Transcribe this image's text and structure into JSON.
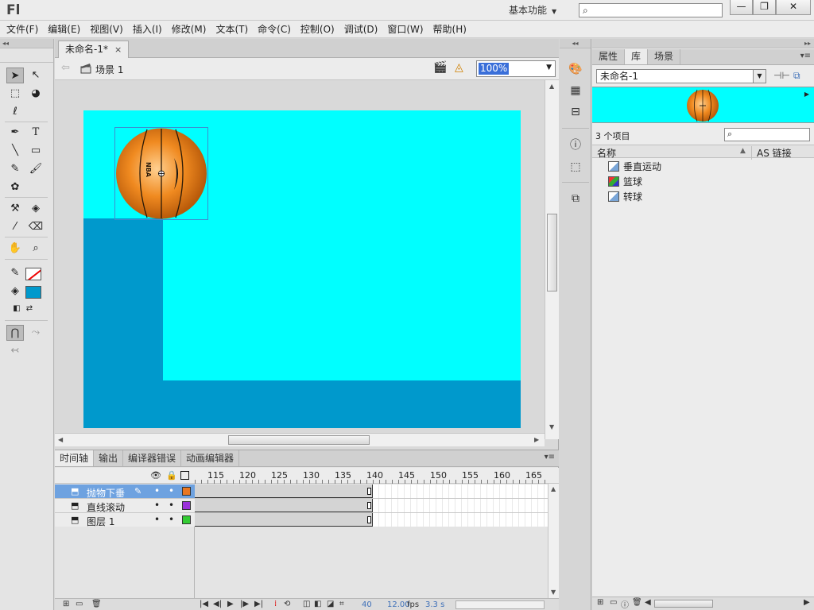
{
  "app": {
    "logo": "Fl",
    "workspace": "基本功能",
    "window_buttons": {
      "minimize": "—",
      "maximize": "❐",
      "close": "✕"
    }
  },
  "menu": [
    "文件(F)",
    "编辑(E)",
    "视图(V)",
    "插入(I)",
    "修改(M)",
    "文本(T)",
    "命令(C)",
    "控制(O)",
    "调试(D)",
    "窗口(W)",
    "帮助(H)"
  ],
  "document": {
    "tab_label": "未命名-1*",
    "tab_close": "×",
    "scene_label": "场景 1",
    "zoom_value": "100%"
  },
  "stage": {
    "bg_color": "#00ffff",
    "shape_color": "#0099cc",
    "ball_label": "NBA"
  },
  "timeline": {
    "tabs": [
      "时间轴",
      "输出",
      "编译器错误",
      "动画编辑器"
    ],
    "frame_numbers": [
      "115",
      "120",
      "125",
      "130",
      "135",
      "140",
      "145",
      "150",
      "155",
      "160",
      "165"
    ],
    "layers": [
      {
        "name": "抛物下垂",
        "color": "#e87722",
        "selected": true
      },
      {
        "name": "直线滚动",
        "color": "#9b30d9",
        "selected": false
      },
      {
        "name": "图层 1",
        "color": "#33cc33",
        "selected": false
      }
    ],
    "footer": {
      "current_frame": "40",
      "fps": "12.00",
      "fps_unit": "fps",
      "elapsed": "3.3 s"
    }
  },
  "library": {
    "tabs": [
      "属性",
      "库",
      "场景"
    ],
    "active_tab": "库",
    "document_select": "未命名-1",
    "item_count": "3 个项目",
    "col_name": "名称",
    "col_linkage": "AS 链接",
    "items": [
      {
        "name": "垂直运动",
        "kind": "movieclip"
      },
      {
        "name": "篮球",
        "kind": "graphic"
      },
      {
        "name": "转球",
        "kind": "movieclip"
      }
    ]
  }
}
